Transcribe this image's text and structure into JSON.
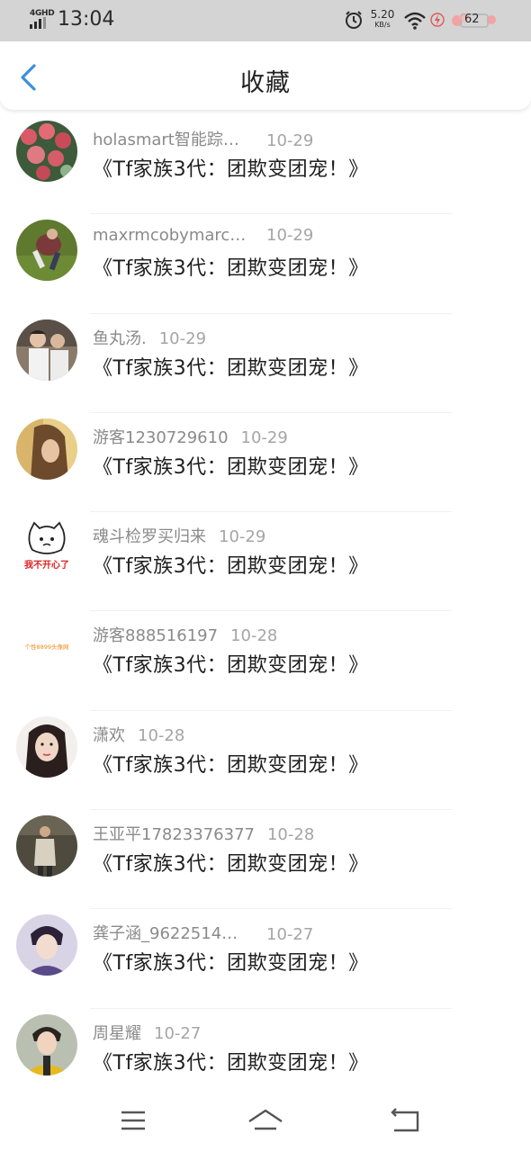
{
  "status_bar": {
    "network": "4GHD",
    "time": "13:04",
    "net_speed_value": "5.20",
    "net_speed_unit": "KB/s",
    "battery": "62"
  },
  "header": {
    "title": "收藏"
  },
  "items": [
    {
      "name": "holasmart智能踪…",
      "date": "10-29",
      "text": "《Tf家族3代：团欺变团宠！》",
      "avatar": "flowers"
    },
    {
      "name": "maxrmcobymarc…",
      "date": "10-29",
      "text": "《Tf家族3代：团欺变团宠！》",
      "avatar": "grass-person"
    },
    {
      "name": "鱼丸汤.",
      "date": "10-29",
      "text": "《Tf家族3代：团欺变团宠！》",
      "avatar": "two-boys"
    },
    {
      "name": "游客1230729610",
      "date": "10-29",
      "text": "《Tf家族3代：团欺变团宠！》",
      "avatar": "warm-portrait"
    },
    {
      "name": "魂斗检罗买归来",
      "date": "10-29",
      "text": "《Tf家族3代：团欺变团宠！》",
      "avatar": "cat-cartoon",
      "avatar_caption": "我不开心了"
    },
    {
      "name": "游客888516197",
      "date": "10-28",
      "text": "《Tf家族3代：团欺变团宠！》",
      "avatar": "orange-logo",
      "avatar_caption": "个性8899头像网"
    },
    {
      "name": "潇欢",
      "date": "10-28",
      "text": "《Tf家族3代：团欺变团宠！》",
      "avatar": "girl-portrait"
    },
    {
      "name": "王亚平17823376377",
      "date": "10-28",
      "text": "《Tf家族3代：团欺变团宠！》",
      "avatar": "person-standing"
    },
    {
      "name": "龚子涵_9622514…",
      "date": "10-27",
      "text": "《Tf家族3代：团欺变团宠！》",
      "avatar": "boy-purple"
    },
    {
      "name": "周星耀",
      "date": "10-27",
      "text": "《Tf家族3代：团欺变团宠！》",
      "avatar": "boy-yellow"
    }
  ],
  "nav": {
    "menu_icon": "menu-icon",
    "home_icon": "home-icon",
    "back_icon": "back-nav-icon"
  },
  "colors": {
    "accent": "#3a8fe0",
    "status_bar_bg": "#d4d4d4",
    "name_text": "#8a8a8a",
    "content_text": "#1f1f1f"
  }
}
